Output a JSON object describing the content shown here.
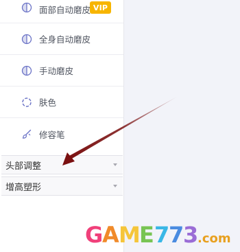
{
  "menu": {
    "items": [
      {
        "label": "面部自动磨皮",
        "icon": "half-circle-icon",
        "badge": "VIP"
      },
      {
        "label": "全身自动磨皮",
        "icon": "half-circle-icon"
      },
      {
        "label": "手动磨皮",
        "icon": "half-circle-icon"
      },
      {
        "label": "肤色",
        "icon": "dashed-circle-icon"
      },
      {
        "label": "修容笔",
        "icon": "brush-icon"
      }
    ]
  },
  "sections": [
    {
      "label": "头部调整"
    },
    {
      "label": "增高塑形"
    }
  ],
  "watermark": {
    "text": "GAME773.com",
    "logo_letters": [
      "G",
      "A",
      "M",
      "E",
      "7",
      "7",
      "3",
      ".com"
    ]
  },
  "colors": {
    "icon": "#6b73c6",
    "vip": "#f7b500",
    "annotation_arrow": "#7a1010"
  }
}
